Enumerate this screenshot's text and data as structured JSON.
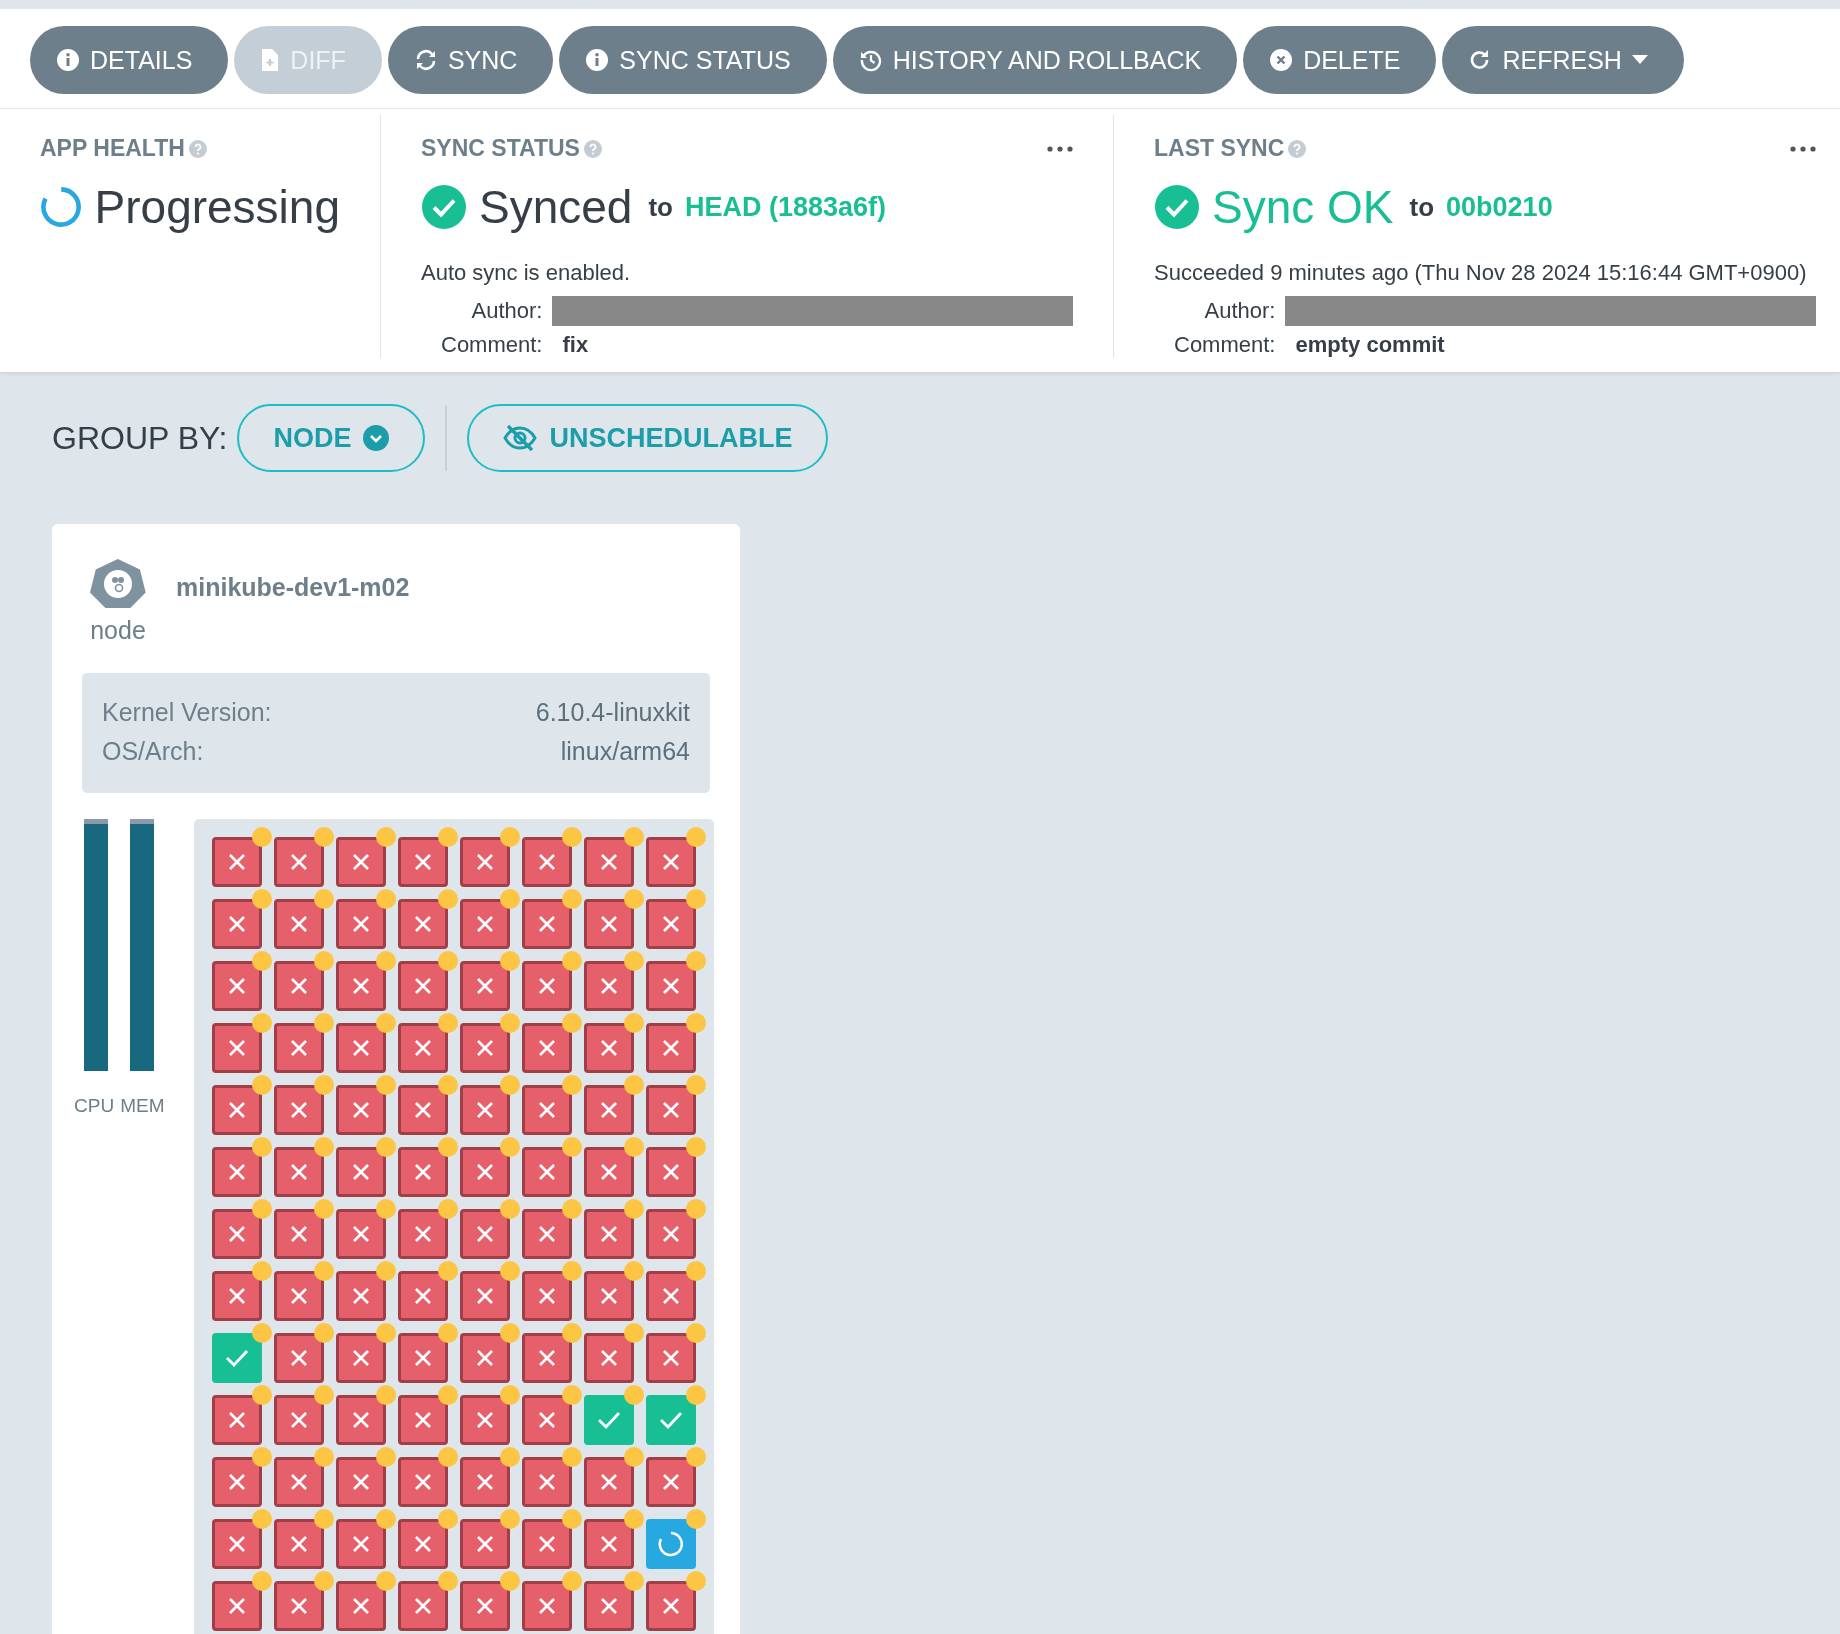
{
  "toolbar": [
    {
      "label": "DETAILS",
      "disabled": false,
      "dropdown": false
    },
    {
      "label": "DIFF",
      "disabled": true,
      "dropdown": false
    },
    {
      "label": "SYNC",
      "disabled": false,
      "dropdown": false
    },
    {
      "label": "SYNC STATUS",
      "disabled": false,
      "dropdown": false
    },
    {
      "label": "HISTORY AND ROLLBACK",
      "disabled": false,
      "dropdown": false
    },
    {
      "label": "DELETE",
      "disabled": false,
      "dropdown": false
    },
    {
      "label": "REFRESH",
      "disabled": false,
      "dropdown": true
    }
  ],
  "app_health": {
    "title": "APP HEALTH",
    "status": "Progressing"
  },
  "sync_status": {
    "title": "SYNC STATUS",
    "status": "Synced",
    "to": "to",
    "revision": "HEAD (1883a6f)",
    "note": "Auto sync is enabled.",
    "author_label": "Author:",
    "comment_label": "Comment:",
    "comment": "fix"
  },
  "last_sync": {
    "title": "LAST SYNC",
    "status": "Sync OK",
    "to": "to",
    "revision": "00b0210",
    "note": "Succeeded 9 minutes ago (Thu Nov 28 2024 15:16:44 GMT+0900)",
    "author_label": "Author:",
    "comment_label": "Comment:",
    "comment": "empty commit"
  },
  "group_by": {
    "label": "GROUP BY:",
    "value": "NODE",
    "filter": "UNSCHEDULABLE"
  },
  "node": {
    "name": "minikube-dev1-m02",
    "type": "node",
    "info": [
      {
        "label": "Kernel Version:",
        "value": "6.10.4-linuxkit"
      },
      {
        "label": "OS/Arch:",
        "value": "linux/arm64"
      }
    ],
    "meters": [
      {
        "name": "CPU",
        "level": 0.98
      },
      {
        "name": "MEM",
        "level": 0.98
      }
    ],
    "pod_rows": [
      {
        "cells": [
          {
            "kind": "failed",
            "warning": true
          },
          {
            "kind": "failed",
            "warning": true
          },
          {
            "kind": "failed",
            "warning": true
          },
          {
            "kind": "failed",
            "warning": true
          },
          {
            "kind": "failed",
            "warning": true
          },
          {
            "kind": "failed",
            "warning": true
          },
          {
            "kind": "failed",
            "warning": true
          },
          {
            "kind": "failed",
            "warning": true
          }
        ]
      },
      {
        "cells": [
          {
            "kind": "failed",
            "warning": true
          },
          {
            "kind": "failed",
            "warning": true
          },
          {
            "kind": "failed",
            "warning": true
          },
          {
            "kind": "failed",
            "warning": true
          },
          {
            "kind": "failed",
            "warning": true
          },
          {
            "kind": "failed",
            "warning": true
          },
          {
            "kind": "failed",
            "warning": true
          },
          {
            "kind": "failed",
            "warning": true
          }
        ]
      },
      {
        "cells": [
          {
            "kind": "failed",
            "warning": true
          },
          {
            "kind": "failed",
            "warning": true
          },
          {
            "kind": "failed",
            "warning": true
          },
          {
            "kind": "failed",
            "warning": true
          },
          {
            "kind": "failed",
            "warning": true
          },
          {
            "kind": "failed",
            "warning": true
          },
          {
            "kind": "failed",
            "warning": true
          },
          {
            "kind": "failed",
            "warning": true
          }
        ]
      },
      {
        "cells": [
          {
            "kind": "failed",
            "warning": true
          },
          {
            "kind": "failed",
            "warning": true
          },
          {
            "kind": "failed",
            "warning": true
          },
          {
            "kind": "failed",
            "warning": true
          },
          {
            "kind": "failed",
            "warning": true
          },
          {
            "kind": "failed",
            "warning": true
          },
          {
            "kind": "failed",
            "warning": true
          },
          {
            "kind": "failed",
            "warning": true
          }
        ]
      },
      {
        "cells": [
          {
            "kind": "failed",
            "warning": true
          },
          {
            "kind": "failed",
            "warning": true
          },
          {
            "kind": "failed",
            "warning": true
          },
          {
            "kind": "failed",
            "warning": true
          },
          {
            "kind": "failed",
            "warning": true
          },
          {
            "kind": "failed",
            "warning": true
          },
          {
            "kind": "failed",
            "warning": true
          },
          {
            "kind": "failed",
            "warning": true
          }
        ]
      },
      {
        "cells": [
          {
            "kind": "failed",
            "warning": true
          },
          {
            "kind": "failed",
            "warning": true
          },
          {
            "kind": "failed",
            "warning": true
          },
          {
            "kind": "failed",
            "warning": true
          },
          {
            "kind": "failed",
            "warning": true
          },
          {
            "kind": "failed",
            "warning": true
          },
          {
            "kind": "failed",
            "warning": true
          },
          {
            "kind": "failed",
            "warning": true
          }
        ]
      },
      {
        "cells": [
          {
            "kind": "failed",
            "warning": true
          },
          {
            "kind": "failed",
            "warning": true
          },
          {
            "kind": "failed",
            "warning": true
          },
          {
            "kind": "failed",
            "warning": true
          },
          {
            "kind": "failed",
            "warning": true
          },
          {
            "kind": "failed",
            "warning": true
          },
          {
            "kind": "failed",
            "warning": true
          },
          {
            "kind": "failed",
            "warning": true
          }
        ]
      },
      {
        "cells": [
          {
            "kind": "failed",
            "warning": true
          },
          {
            "kind": "failed",
            "warning": true
          },
          {
            "kind": "failed",
            "warning": true
          },
          {
            "kind": "failed",
            "warning": true
          },
          {
            "kind": "failed",
            "warning": true
          },
          {
            "kind": "failed",
            "warning": true
          },
          {
            "kind": "failed",
            "warning": true
          },
          {
            "kind": "failed",
            "warning": true
          }
        ]
      },
      {
        "cells": [
          {
            "kind": "healthy",
            "warning": true
          },
          {
            "kind": "failed",
            "warning": true
          },
          {
            "kind": "failed",
            "warning": true
          },
          {
            "kind": "failed",
            "warning": true
          },
          {
            "kind": "failed",
            "warning": true
          },
          {
            "kind": "failed",
            "warning": true
          },
          {
            "kind": "failed",
            "warning": true
          },
          {
            "kind": "failed",
            "warning": true
          }
        ]
      },
      {
        "cells": [
          {
            "kind": "failed",
            "warning": true
          },
          {
            "kind": "failed",
            "warning": true
          },
          {
            "kind": "failed",
            "warning": true
          },
          {
            "kind": "failed",
            "warning": true
          },
          {
            "kind": "failed",
            "warning": true
          },
          {
            "kind": "failed",
            "warning": true
          },
          {
            "kind": "healthy",
            "warning": true
          },
          {
            "kind": "healthy",
            "warning": true
          }
        ]
      },
      {
        "cells": [
          {
            "kind": "failed",
            "warning": true
          },
          {
            "kind": "failed",
            "warning": true
          },
          {
            "kind": "failed",
            "warning": true
          },
          {
            "kind": "failed",
            "warning": true
          },
          {
            "kind": "failed",
            "warning": true
          },
          {
            "kind": "failed",
            "warning": true
          },
          {
            "kind": "failed",
            "warning": true
          },
          {
            "kind": "failed",
            "warning": true
          }
        ]
      },
      {
        "cells": [
          {
            "kind": "failed",
            "warning": true
          },
          {
            "kind": "failed",
            "warning": true
          },
          {
            "kind": "failed",
            "warning": true
          },
          {
            "kind": "failed",
            "warning": true
          },
          {
            "kind": "failed",
            "warning": true
          },
          {
            "kind": "failed",
            "warning": true
          },
          {
            "kind": "failed",
            "warning": true
          },
          {
            "kind": "progressing",
            "warning": true
          }
        ]
      },
      {
        "cells": [
          {
            "kind": "failed",
            "warning": true
          },
          {
            "kind": "failed",
            "warning": true
          },
          {
            "kind": "failed",
            "warning": true
          },
          {
            "kind": "failed",
            "warning": true
          },
          {
            "kind": "failed",
            "warning": true
          },
          {
            "kind": "failed",
            "warning": true
          },
          {
            "kind": "failed",
            "warning": true
          },
          {
            "kind": "failed",
            "warning": true
          }
        ]
      }
    ]
  }
}
